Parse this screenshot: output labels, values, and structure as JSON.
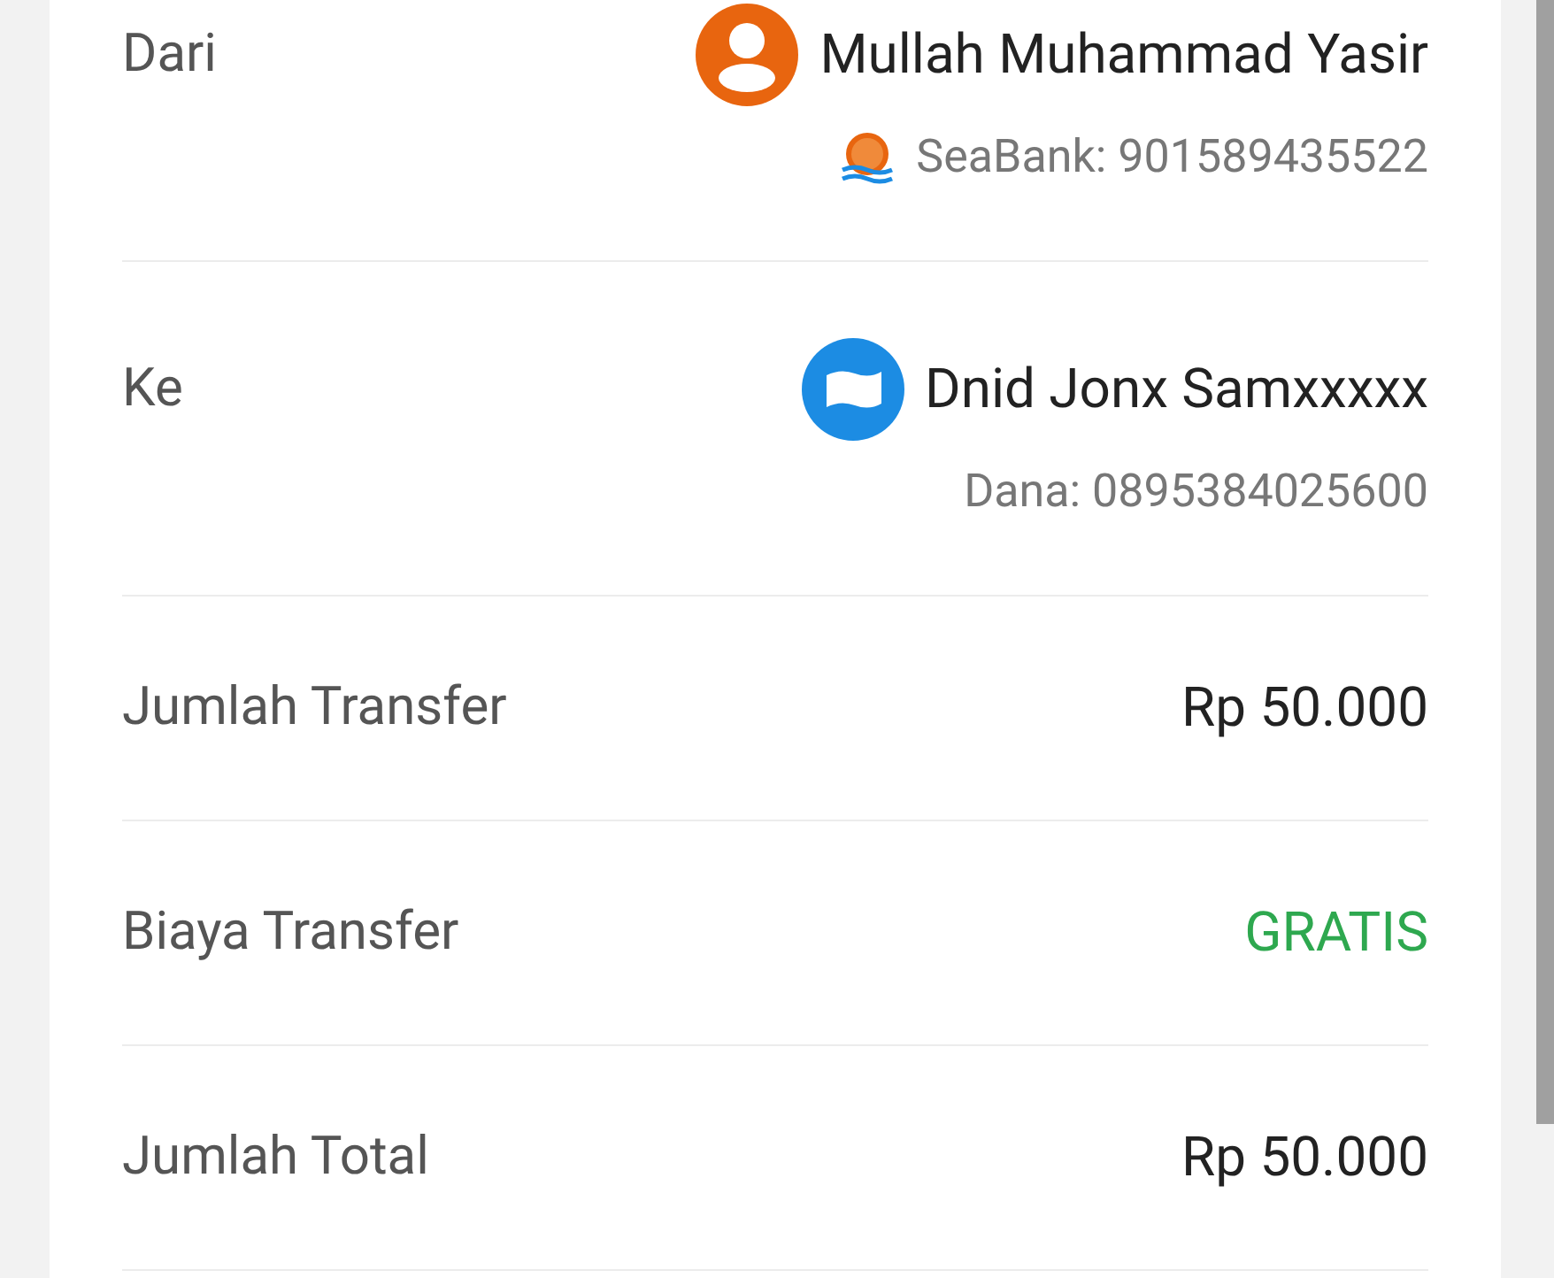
{
  "rows": [
    {
      "kind": "party",
      "label": "Dari",
      "name": "Mullah Muhammad Yasir",
      "avatar": {
        "kind": "person"
      },
      "account": "SeaBank: 901589435522",
      "bank_logo": true
    },
    {
      "kind": "party",
      "label": "Ke",
      "name": "Dnid Jonx Samxxxxx",
      "avatar": {
        "kind": "wallet"
      },
      "account": "Dana: 0895384025600",
      "bank_logo": false
    },
    {
      "kind": "amount",
      "label": "Jumlah Transfer",
      "value": "Rp 50.000",
      "color": "#222222"
    },
    {
      "kind": "amount",
      "label": "Biaya Transfer",
      "value": "GRATIS",
      "color": "#2ea84f"
    },
    {
      "kind": "amount",
      "label": "Jumlah Total",
      "value": "Rp 50.000",
      "color": "#222222"
    }
  ]
}
